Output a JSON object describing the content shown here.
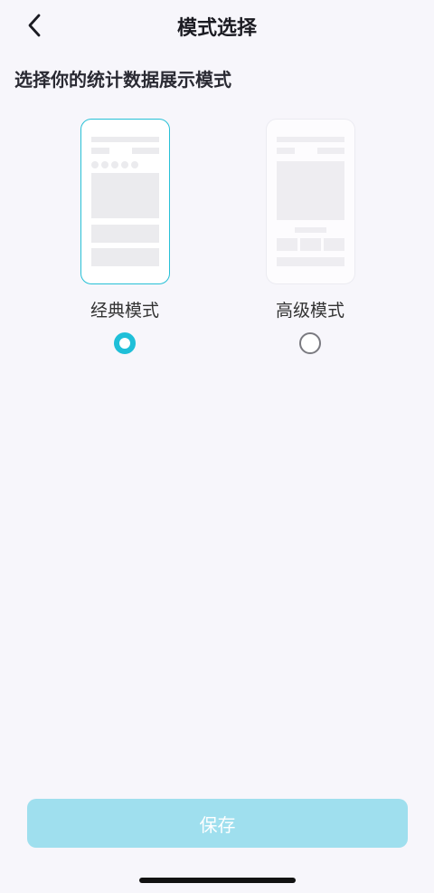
{
  "header": {
    "title": "模式选择",
    "back_icon": "chevron-left-icon"
  },
  "subtitle": "选择你的统计数据展示模式",
  "options": [
    {
      "label": "经典模式",
      "selected": true
    },
    {
      "label": "高级模式",
      "selected": false
    }
  ],
  "colors": {
    "accent": "#1fbfd8",
    "save_button_bg": "#9fdfee",
    "background": "#f7f6fb"
  },
  "save_button": {
    "label": "保存"
  }
}
